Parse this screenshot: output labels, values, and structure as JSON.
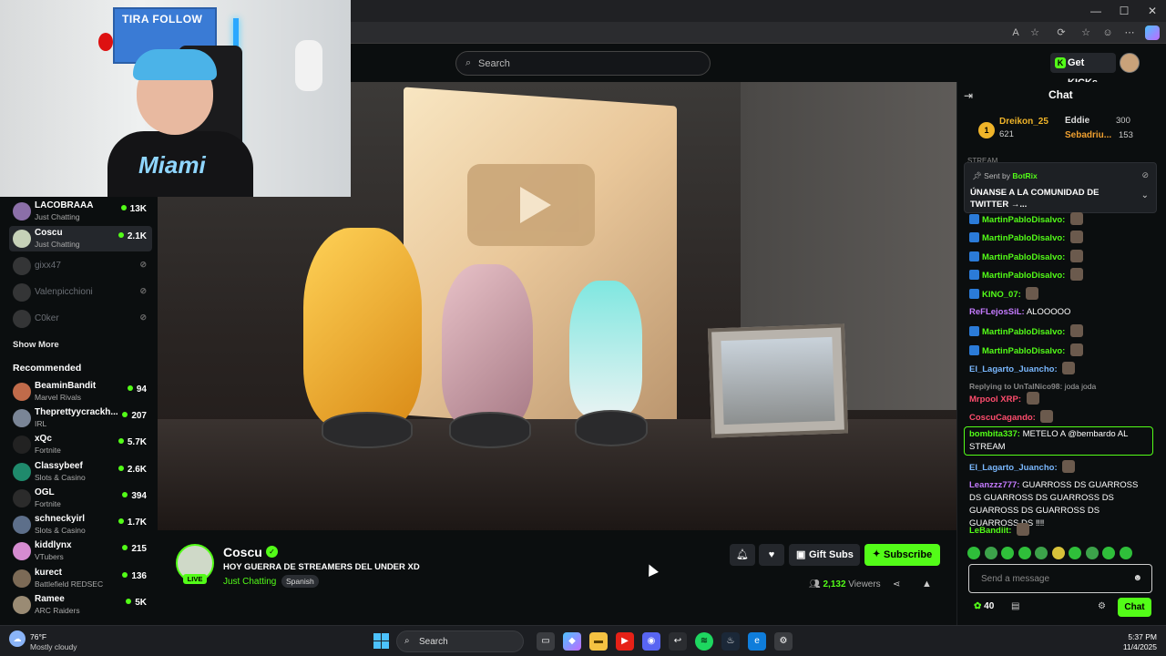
{
  "browser": {
    "window_controls": {
      "minimize": "—",
      "maximize": "☐",
      "close": "✕"
    },
    "address_icons": [
      "A",
      "☆",
      "⟳",
      "☆",
      "☺",
      "⋯"
    ]
  },
  "kick_header": {
    "search_placeholder": "Search",
    "get_kicks_label": "Get KICKs"
  },
  "webcam": {
    "banner_text": "TIRA FOLLOW",
    "shirt_text": "Miami"
  },
  "sidebar": {
    "following": [
      {
        "name": "LACOBRAAA",
        "category": "Just Chatting",
        "viewers": "13K",
        "live": true
      },
      {
        "name": "Coscu",
        "category": "Just Chatting",
        "viewers": "2.1K",
        "live": true,
        "active": true
      },
      {
        "name": "gixx47",
        "category": "",
        "viewers": "",
        "live": false
      },
      {
        "name": "Valenpicchioni",
        "category": "",
        "viewers": "",
        "live": false
      },
      {
        "name": "C0ker",
        "category": "",
        "viewers": "",
        "live": false
      }
    ],
    "show_more": "Show More",
    "recommended_title": "Recommended",
    "recommended": [
      {
        "name": "BeaminBandit",
        "category": "Marvel Rivals",
        "viewers": "94",
        "color": "#c06b4a"
      },
      {
        "name": "Theprettyycrackh...",
        "category": "IRL",
        "viewers": "207",
        "color": "#7a8596"
      },
      {
        "name": "xQc",
        "category": "Fortnite",
        "viewers": "5.7K",
        "color": "#222222"
      },
      {
        "name": "Classybeef",
        "category": "Slots & Casino",
        "viewers": "2.6K",
        "color": "#1f8a6c"
      },
      {
        "name": "OGL",
        "category": "Fortnite",
        "viewers": "394",
        "color": "#2b2b2b"
      },
      {
        "name": "schneckyirl",
        "category": "Slots & Casino",
        "viewers": "1.7K",
        "color": "#5d6f8a"
      },
      {
        "name": "kiddlynx",
        "category": "VTubers",
        "viewers": "215",
        "color": "#d58bd0"
      },
      {
        "name": "kurect",
        "category": "Battlefield REDSEC",
        "viewers": "136",
        "color": "#7c6a56"
      },
      {
        "name": "Ramee",
        "category": "ARC Raiders",
        "viewers": "5K",
        "color": "#9a8b74"
      }
    ]
  },
  "stream": {
    "channel_name": "Coscu",
    "live_badge": "LIVE",
    "title": "HOY GUERRA DE STREAMERS DEL UNDER XD",
    "category": "Just Chatting",
    "language": "Spanish",
    "gift_subs_label": "Gift Subs",
    "subscribe_label": "Subscribe",
    "viewers_count": "2,132",
    "viewers_label": "Viewers"
  },
  "chat": {
    "title": "Chat",
    "leaderboard": [
      {
        "name": "Dreikon_25",
        "value": "621",
        "color": "#f0b429"
      },
      {
        "name": "Eddie",
        "value": "300",
        "color": "#dddddd"
      },
      {
        "name": "Sebadriu...",
        "value": "153",
        "color": "#f0a030"
      }
    ],
    "stream_tag": "STREAM",
    "pinned": {
      "sent_by_label": "Sent by",
      "sender": "BotRix",
      "message": "ÚNANSE A LA COMUNIDAD DE TWITTER →..."
    },
    "messages": [
      {
        "user": "MartinPabloDisalvo:",
        "text": "",
        "color": "#53fc18"
      },
      {
        "user": "MartinPabloDisalvo:",
        "text": "",
        "color": "#53fc18"
      },
      {
        "user": "MartinPabloDisalvo:",
        "text": "",
        "color": "#53fc18"
      },
      {
        "user": "MartinPabloDisalvo:",
        "text": "",
        "color": "#53fc18"
      },
      {
        "user": "KINO_07:",
        "text": "",
        "color": "#53fc18"
      },
      {
        "user": "ReFLejosSiL:",
        "text": "ALOOOOO",
        "color": "#c57bff"
      },
      {
        "user": "MartinPabloDisalvo:",
        "text": "",
        "color": "#53fc18"
      },
      {
        "user": "MartinPabloDisalvo:",
        "text": "",
        "color": "#53fc18"
      },
      {
        "user": "El_Lagarto_Juancho:",
        "text": "",
        "color": "#7ab8ff"
      },
      {
        "user": "Replying to UnTalNico98:",
        "text": "joda joda",
        "color": "#888888"
      },
      {
        "user": "Mrpool XRP:",
        "text": "",
        "color": "#ff4d6d"
      },
      {
        "user": "CoscuCagando:",
        "text": "",
        "color": "#ff4d6d"
      },
      {
        "user": "bombita337:",
        "text": "METELO A @bembardo AL STREAM",
        "color": "#53fc18"
      },
      {
        "user": "El_Lagarto_Juancho:",
        "text": "",
        "color": "#7ab8ff"
      },
      {
        "user": "Leanzzz777:",
        "text": "GUARROSS DS GUARROSS DS GUARROSS DS GUARROSS DS GUARROSS DS GUARROSS DS GUARROSS DS ‼‼",
        "color": "#c57bff"
      },
      {
        "user": "LeBandiit:",
        "text": "",
        "color": "#53fc18"
      }
    ],
    "input_placeholder": "Send a message",
    "points": "40",
    "chat_button": "Chat"
  },
  "taskbar": {
    "temperature": "76°F",
    "weather": "Mostly cloudy",
    "search_placeholder": "Search",
    "time": "5:37 PM",
    "date": "11/4/2025"
  },
  "colors": {
    "accent": "#53fc18",
    "background": "#0b0e0f"
  }
}
